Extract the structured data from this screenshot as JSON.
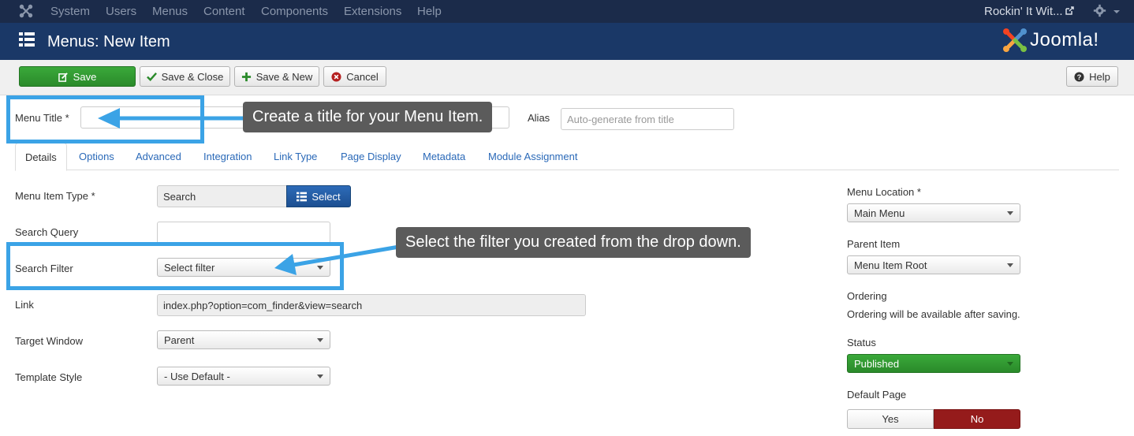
{
  "navbar": {
    "items": [
      "System",
      "Users",
      "Menus",
      "Content",
      "Components",
      "Extensions",
      "Help"
    ],
    "site_name": "Rockin' It Wit..."
  },
  "header": {
    "title": "Menus: New Item",
    "brand": "Joomla!"
  },
  "toolbar": {
    "save": "Save",
    "save_close": "Save & Close",
    "save_new": "Save & New",
    "cancel": "Cancel",
    "help": "Help"
  },
  "form": {
    "menu_title_label": "Menu Title *",
    "menu_title_value": "",
    "alias_label": "Alias",
    "alias_placeholder": "Auto-generate from title"
  },
  "tabs": [
    "Details",
    "Options",
    "Advanced",
    "Integration",
    "Link Type",
    "Page Display",
    "Metadata",
    "Module Assignment"
  ],
  "details": {
    "menu_item_type_label": "Menu Item Type *",
    "menu_item_type_value": "Search",
    "select_button": "Select",
    "search_query_label": "Search Query",
    "search_query_value": "",
    "search_filter_label": "Search Filter",
    "search_filter_value": "Select filter",
    "link_label": "Link",
    "link_value": "index.php?option=com_finder&view=search",
    "target_window_label": "Target Window",
    "target_window_value": "Parent",
    "template_style_label": "Template Style",
    "template_style_value": "- Use Default -"
  },
  "sidebar": {
    "menu_location_label": "Menu Location *",
    "menu_location_value": "Main Menu",
    "parent_item_label": "Parent Item",
    "parent_item_value": "Menu Item Root",
    "ordering_label": "Ordering",
    "ordering_note": "Ordering will be available after saving.",
    "status_label": "Status",
    "status_value": "Published",
    "default_page_label": "Default Page",
    "default_yes": "Yes",
    "default_no": "No"
  },
  "annotations": {
    "callout_title": "Create a title for your Menu Item.",
    "callout_filter": "Select the filter you created from the drop down."
  },
  "colors": {
    "navbar_bg": "#1b2b4a",
    "header_bg": "#1a3867",
    "save_green": "#2f992f",
    "select_blue": "#1c4f91",
    "no_red": "#951b1b",
    "highlight_blue": "#3ba3e6",
    "callout_gray": "#5b5b5b"
  }
}
